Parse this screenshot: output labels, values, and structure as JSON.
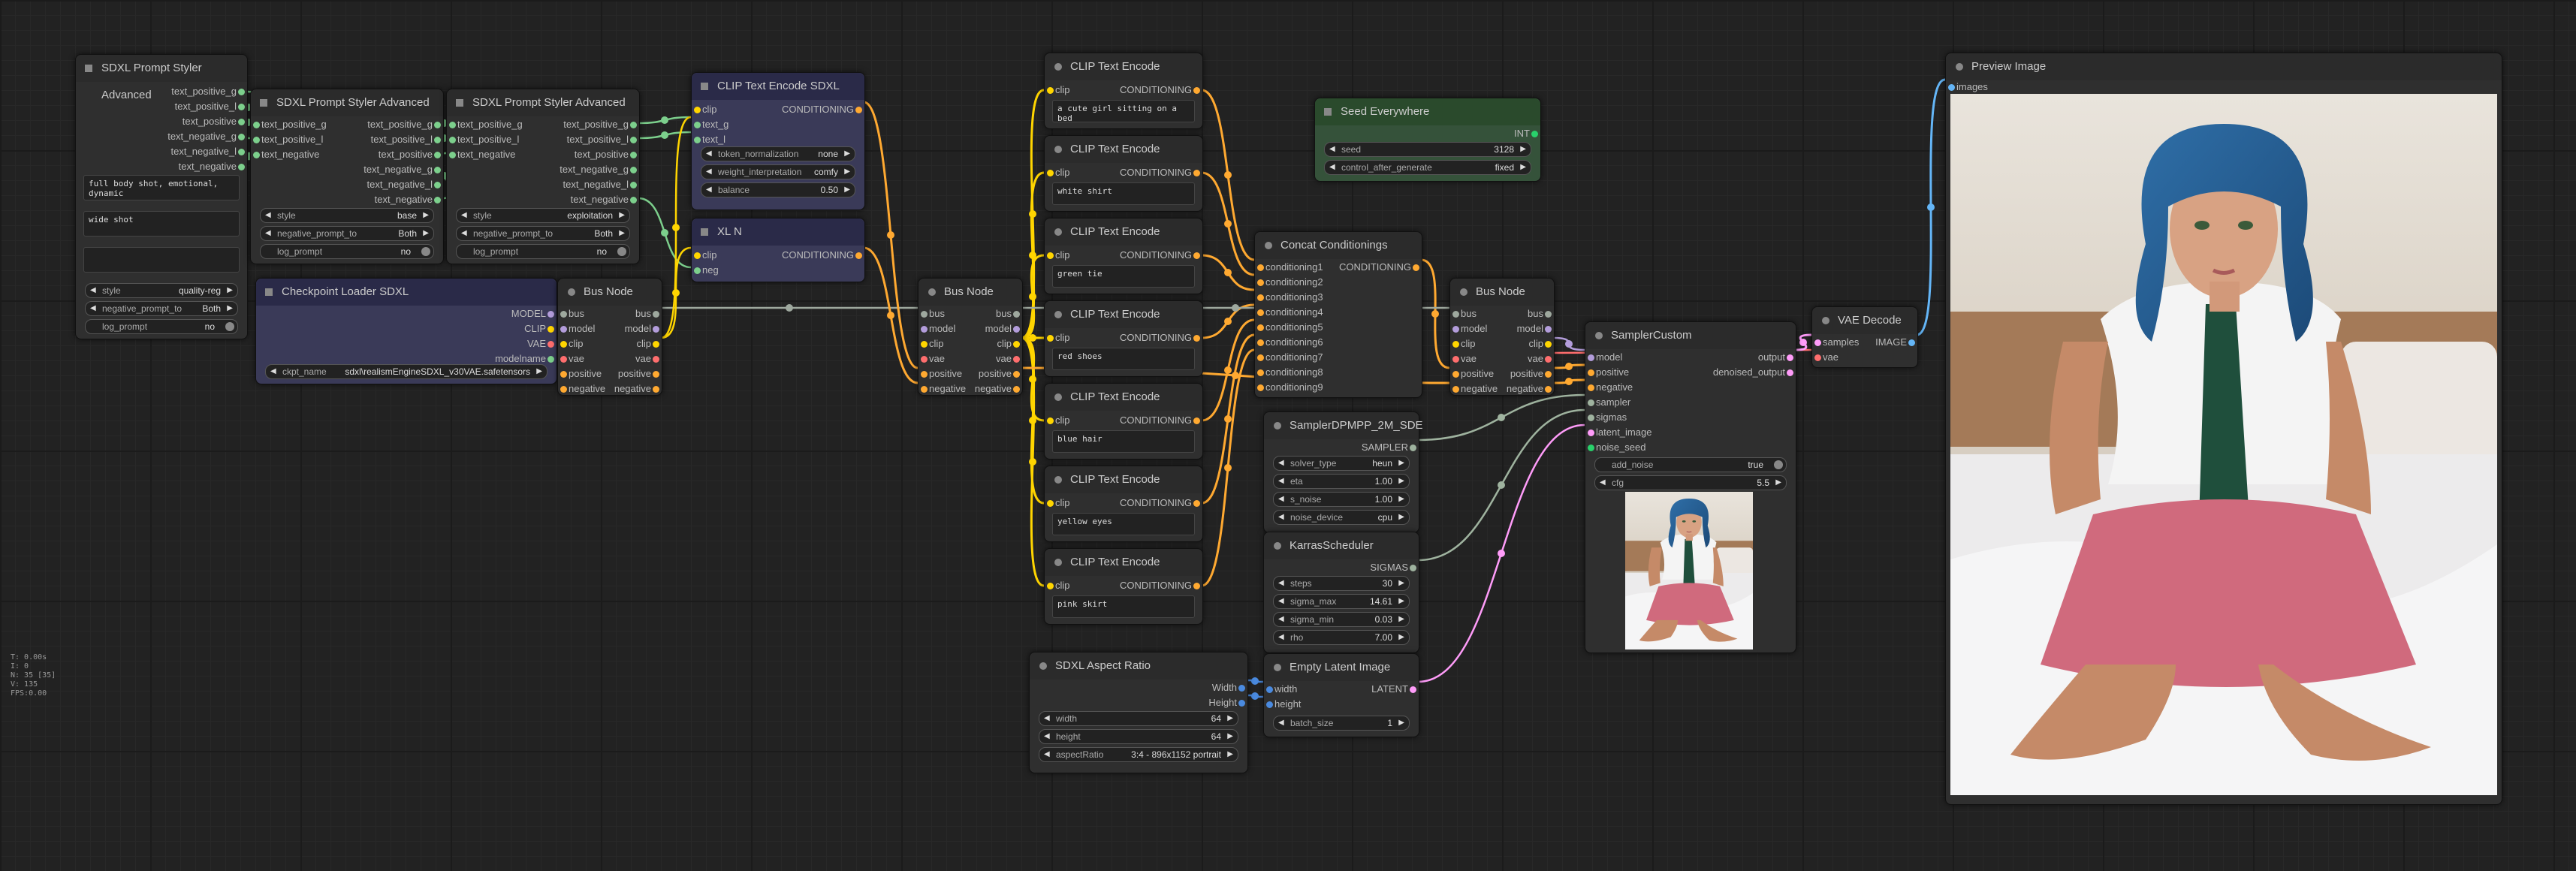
{
  "colors": {
    "clip": "#ffd500",
    "conditioning": "#ffa931",
    "model": "#b39ddb",
    "vae": "#ff6e6e",
    "latent": "#ff9cf9",
    "sampler": "#9fb39f",
    "sigmas": "#9fb39f",
    "int": "#29d16b",
    "image": "#64b5f6",
    "bus": "#9ea89e",
    "string": "#7ccf8c",
    "width": "#4a8adf"
  },
  "stats": [
    "T: 0.00s",
    "I: 0",
    "N: 35 [35]",
    "V: 135",
    "FPS:0.00"
  ],
  "nodes": {
    "styler1": {
      "title": "SDXL Prompt Styler Advanced",
      "outputs": [
        "text_positive_g",
        "text_positive_l",
        "text_positive",
        "text_negative_g",
        "text_negative_l",
        "text_negative"
      ],
      "text1": "full body shot, emotional,\ndynamic",
      "text2": "wide shot",
      "widgets": [
        {
          "label": "style",
          "value": "quality-reg"
        },
        {
          "label": "negative_prompt_to",
          "value": "Both"
        },
        {
          "label": "log_prompt",
          "value": "no"
        }
      ]
    },
    "styler2": {
      "title": "SDXL Prompt Styler Advanced",
      "inputs": [
        "text_positive_g",
        "text_positive_l",
        "text_negative"
      ],
      "outputs": [
        "text_positive_g",
        "text_positive_l",
        "text_positive",
        "text_negative_g",
        "text_negative_l",
        "text_negative"
      ],
      "widgets": [
        {
          "label": "style",
          "value": "base"
        },
        {
          "label": "negative_prompt_to",
          "value": "Both"
        },
        {
          "label": "log_prompt",
          "value": "no"
        }
      ]
    },
    "styler3": {
      "title": "SDXL Prompt Styler Advanced",
      "inputs": [
        "text_positive_g",
        "text_positive_l",
        "text_negative"
      ],
      "outputs": [
        "text_positive_g",
        "text_positive_l",
        "text_positive",
        "text_negative_g",
        "text_negative_l",
        "text_negative"
      ],
      "widgets": [
        {
          "label": "style",
          "value": "exploitation"
        },
        {
          "label": "negative_prompt_to",
          "value": "Both"
        },
        {
          "label": "log_prompt",
          "value": "no"
        }
      ]
    },
    "ckpt": {
      "title": "Checkpoint Loader SDXL",
      "outputs": [
        "MODEL",
        "CLIP",
        "VAE",
        "modelname"
      ],
      "widgets": [
        {
          "label": "ckpt_name",
          "value": "sdxl\\realismEngineSDXL_v30VAE.safetensors"
        }
      ]
    },
    "bus1": {
      "title": "Bus Node",
      "rows": [
        [
          "bus",
          "bus"
        ],
        [
          "model",
          "model"
        ],
        [
          "clip",
          "clip"
        ],
        [
          "vae",
          "vae"
        ],
        [
          "positive",
          "positive"
        ],
        [
          "negative",
          "negative"
        ]
      ]
    },
    "clipsdxl": {
      "title": "CLIP Text Encode SDXL",
      "inputs": [
        "clip",
        "text_g",
        "text_l"
      ],
      "output": "CONDITIONING",
      "widgets": [
        {
          "label": "token_normalization",
          "value": "none"
        },
        {
          "label": "weight_interpretation",
          "value": "comfy"
        },
        {
          "label": "balance",
          "value": "0.50"
        }
      ]
    },
    "xln": {
      "title": "XL N",
      "inputs": [
        "clip",
        "neg"
      ],
      "output": "CONDITIONING"
    },
    "bus2": {
      "title": "Bus Node",
      "rows": [
        [
          "bus",
          "bus"
        ],
        [
          "model",
          "model"
        ],
        [
          "clip",
          "clip"
        ],
        [
          "vae",
          "vae"
        ],
        [
          "positive",
          "positive"
        ],
        [
          "negative",
          "negative"
        ]
      ]
    },
    "clips": [
      {
        "title": "CLIP Text Encode",
        "input": "clip",
        "output": "CONDITIONING",
        "text": "a cute girl sitting on a bed"
      },
      {
        "title": "CLIP Text Encode",
        "input": "clip",
        "output": "CONDITIONING",
        "text": "white shirt"
      },
      {
        "title": "CLIP Text Encode",
        "input": "clip",
        "output": "CONDITIONING",
        "text": "green tie"
      },
      {
        "title": "CLIP Text Encode",
        "input": "clip",
        "output": "CONDITIONING",
        "text": "red shoes"
      },
      {
        "title": "CLIP Text Encode",
        "input": "clip",
        "output": "CONDITIONING",
        "text": "blue hair"
      },
      {
        "title": "CLIP Text Encode",
        "input": "clip",
        "output": "CONDITIONING",
        "text": "yellow eyes"
      },
      {
        "title": "CLIP Text Encode",
        "input": "clip",
        "output": "CONDITIONING",
        "text": "pink skirt"
      }
    ],
    "aspect": {
      "title": "SDXL Aspect Ratio",
      "outputs": [
        "Width",
        "Height"
      ],
      "widgets": [
        {
          "label": "width",
          "value": "64"
        },
        {
          "label": "height",
          "value": "64"
        },
        {
          "label": "aspectRatio",
          "value": "3:4 - 896x1152 portrait"
        }
      ]
    },
    "seed": {
      "title": "Seed Everywhere",
      "output": "INT",
      "widgets": [
        {
          "label": "seed",
          "value": "3128"
        },
        {
          "label": "control_after_generate",
          "value": "fixed"
        }
      ]
    },
    "concat": {
      "title": "Concat Conditionings",
      "inputs": [
        "conditioning1",
        "conditioning2",
        "conditioning3",
        "conditioning4",
        "conditioning5",
        "conditioning6",
        "conditioning7",
        "conditioning8",
        "conditioning9"
      ],
      "output": "CONDITIONING"
    },
    "samplerdpm": {
      "title": "SamplerDPMPP_2M_SDE",
      "output": "SAMPLER",
      "widgets": [
        {
          "label": "solver_type",
          "value": "heun"
        },
        {
          "label": "eta",
          "value": "1.00"
        },
        {
          "label": "s_noise",
          "value": "1.00"
        },
        {
          "label": "noise_device",
          "value": "cpu"
        }
      ]
    },
    "karras": {
      "title": "KarrasScheduler",
      "output": "SIGMAS",
      "widgets": [
        {
          "label": "steps",
          "value": "30"
        },
        {
          "label": "sigma_max",
          "value": "14.61"
        },
        {
          "label": "sigma_min",
          "value": "0.03"
        },
        {
          "label": "rho",
          "value": "7.00"
        }
      ]
    },
    "latent": {
      "title": "Empty Latent Image",
      "inputs": [
        "width",
        "height"
      ],
      "output": "LATENT",
      "widgets": [
        {
          "label": "batch_size",
          "value": "1"
        }
      ]
    },
    "bus3": {
      "title": "Bus Node",
      "rows": [
        [
          "bus",
          "bus"
        ],
        [
          "model",
          "model"
        ],
        [
          "clip",
          "clip"
        ],
        [
          "vae",
          "vae"
        ],
        [
          "positive",
          "positive"
        ],
        [
          "negative",
          "negative"
        ]
      ]
    },
    "samplercustom": {
      "title": "SamplerCustom",
      "inputs": [
        "model",
        "positive",
        "negative",
        "sampler",
        "sigmas",
        "latent_image",
        "noise_seed"
      ],
      "outputs": [
        "output",
        "denoised_output"
      ],
      "widgets": [
        {
          "label": "add_noise",
          "value": "true"
        },
        {
          "label": "cfg",
          "value": "5.5"
        }
      ]
    },
    "vaedecode": {
      "title": "VAE Decode",
      "inputs": [
        "samples",
        "vae"
      ],
      "output": "IMAGE"
    },
    "preview": {
      "title": "Preview Image",
      "input": "images"
    }
  }
}
